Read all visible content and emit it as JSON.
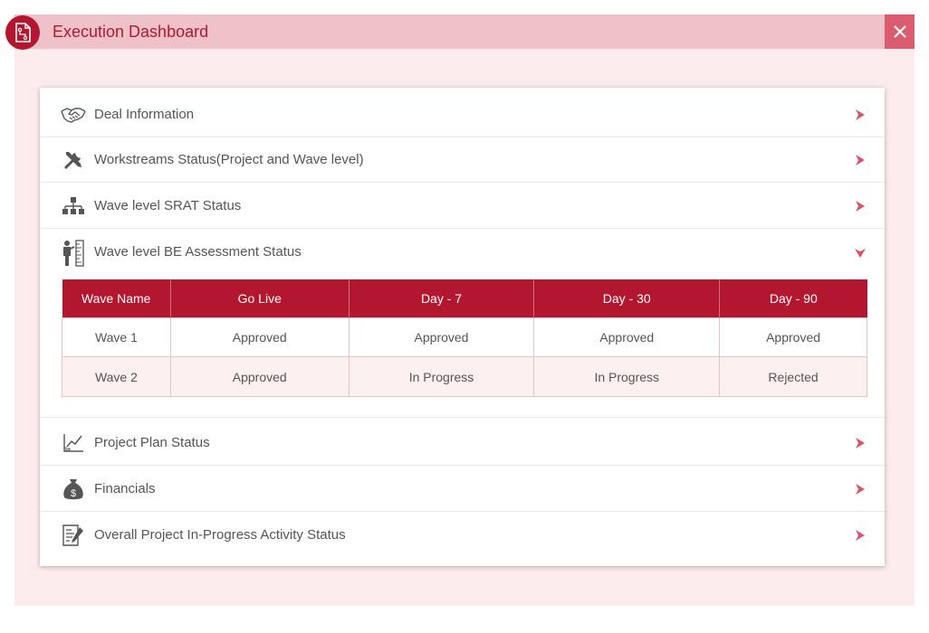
{
  "window": {
    "title": "Execution Dashboard"
  },
  "sections": [
    {
      "label": "Deal Information",
      "icon": "handshake-icon",
      "expanded": false
    },
    {
      "label": "Workstreams Status(Project and Wave level)",
      "icon": "tools-icon",
      "expanded": false
    },
    {
      "label": "Wave level SRAT Status",
      "icon": "hierarchy-icon",
      "expanded": false
    },
    {
      "label": "Wave level BE Assessment Status",
      "icon": "person-measure-icon",
      "expanded": true
    },
    {
      "label": "Project Plan Status",
      "icon": "line-chart-icon",
      "expanded": false
    },
    {
      "label": "Financials",
      "icon": "money-bag-icon",
      "expanded": false
    },
    {
      "label": "Overall Project In-Progress Activity Status",
      "icon": "document-sign-icon",
      "expanded": false
    }
  ],
  "wave_table": {
    "headers": [
      "Wave Name",
      "Go Live",
      "Day - 7",
      "Day - 30",
      "Day - 90"
    ],
    "rows": [
      [
        "Wave 1",
        "Approved",
        "Approved",
        "Approved",
        "Approved"
      ],
      [
        "Wave 2",
        "Approved",
        "In Progress",
        "In Progress",
        "Rejected"
      ]
    ]
  },
  "colors": {
    "accent": "#b3172f",
    "titlebar": "#efc1c8",
    "background": "#fcebed",
    "chevron": "#d9546b"
  }
}
